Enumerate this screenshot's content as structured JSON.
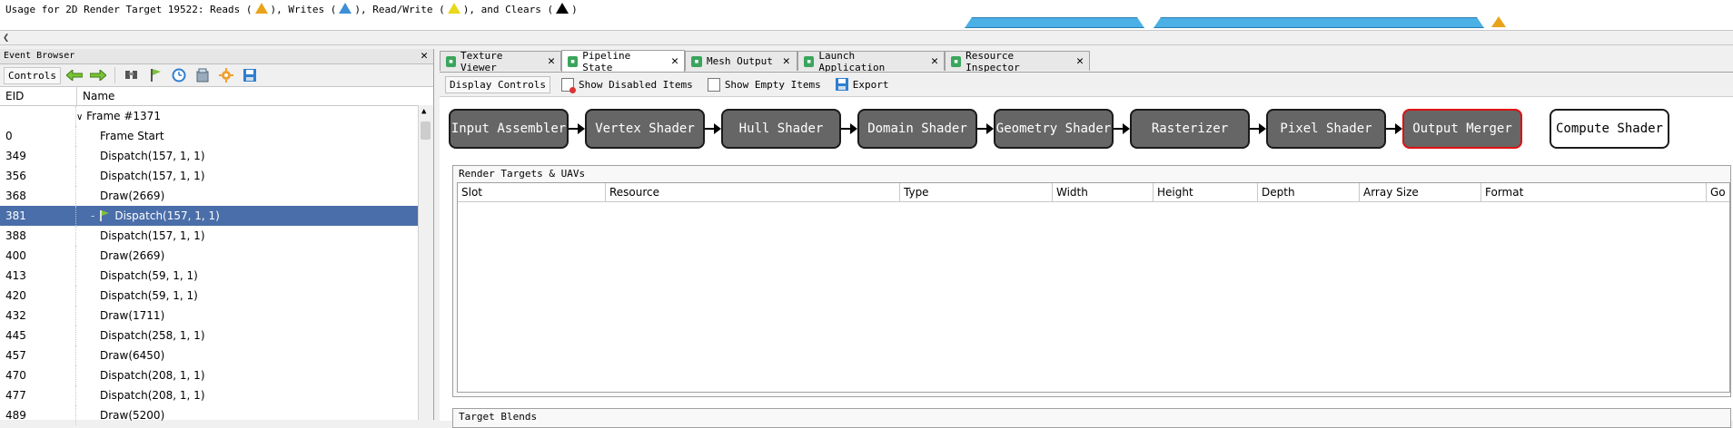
{
  "usage": {
    "prefix": "Usage for 2D Render Target 19522: Reads (",
    "writes": "), Writes (",
    "readwrite": "), Read/Write (",
    "clears": "), and Clears (",
    "suffix": ")",
    "colors": {
      "read": "#e8a31b",
      "write": "#3d8fd6",
      "readwrite": "#e8d81b",
      "clear": "#000000"
    }
  },
  "event_browser": {
    "title": "Event Browser",
    "controls_label": "Controls",
    "toolbar_icons": [
      "back-arrow-icon",
      "forward-arrow-icon",
      "find-icon",
      "bookmark-flag-icon",
      "timer-icon",
      "export-icon",
      "settings-icon",
      "save-icon"
    ],
    "columns": {
      "eid": "EID",
      "name": "Name"
    },
    "frame_label": "Frame #1371",
    "rows": [
      {
        "eid": "0",
        "name": "Frame Start"
      },
      {
        "eid": "349",
        "name": "Dispatch(157, 1, 1)"
      },
      {
        "eid": "356",
        "name": "Dispatch(157, 1, 1)"
      },
      {
        "eid": "368",
        "name": "Draw(2669)"
      },
      {
        "eid": "381",
        "name": "Dispatch(157, 1, 1)",
        "selected": true
      },
      {
        "eid": "388",
        "name": "Dispatch(157, 1, 1)"
      },
      {
        "eid": "400",
        "name": "Draw(2669)"
      },
      {
        "eid": "413",
        "name": "Dispatch(59, 1, 1)"
      },
      {
        "eid": "420",
        "name": "Dispatch(59, 1, 1)"
      },
      {
        "eid": "432",
        "name": "Draw(1711)"
      },
      {
        "eid": "445",
        "name": "Dispatch(258, 1, 1)"
      },
      {
        "eid": "457",
        "name": "Draw(6450)"
      },
      {
        "eid": "470",
        "name": "Dispatch(208, 1, 1)"
      },
      {
        "eid": "477",
        "name": "Dispatch(208, 1, 1)"
      },
      {
        "eid": "489",
        "name": "Draw(5200)"
      }
    ]
  },
  "tabs": [
    {
      "label": "Texture Viewer"
    },
    {
      "label": "Pipeline State",
      "active": true
    },
    {
      "label": "Mesh Output"
    },
    {
      "label": "Launch Application"
    },
    {
      "label": "Resource Inspector"
    }
  ],
  "pipeline": {
    "toolbar": {
      "display_controls": "Display Controls",
      "show_disabled": "Show Disabled Items",
      "show_empty": "Show Empty Items",
      "export": "Export"
    },
    "stages": [
      "Input Assembler",
      "Vertex Shader",
      "Hull Shader",
      "Domain Shader",
      "Geometry Shader",
      "Rasterizer",
      "Pixel Shader",
      "Output Merger"
    ],
    "active_stage": "Output Merger",
    "compute_stage": "Compute Shader",
    "render_targets": {
      "title": "Render Targets & UAVs",
      "columns": [
        "Slot",
        "Resource",
        "Type",
        "Width",
        "Height",
        "Depth",
        "Array Size",
        "Format",
        "Go"
      ]
    },
    "target_blends_title": "Target Blends"
  }
}
